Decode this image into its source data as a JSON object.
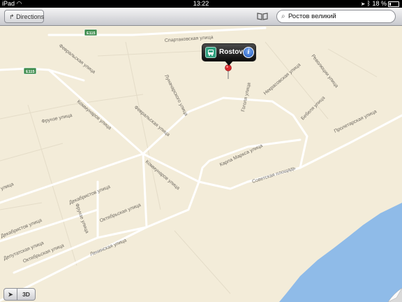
{
  "statusbar": {
    "device": "iPad",
    "time": "13:22",
    "battery": "18 %"
  },
  "toolbar": {
    "directions_label": "Directions",
    "search_value": "Ростов великий"
  },
  "callout": {
    "title": "Rostov"
  },
  "map": {
    "highway_labels": [
      "E115",
      "E115"
    ],
    "street_labels": [
      "Спартаковская улица",
      "Февральская улица",
      "Луначарского улица",
      "Гоголя улица",
      "Некрасовская улица",
      "Революции улица",
      "Бебеля улица",
      "Пролетарская улица",
      "Фрунзе улица",
      "Коммунаров улица",
      "Февральская улица",
      "Карла Маркса улица",
      "Коммунаров улица",
      "Советская площадь",
      "Декабристов улица",
      "Фрунзе улица",
      "Октябрьская улица",
      "Декабристов улица",
      "Депутатская улица",
      "Октябрьская улица",
      "Ленинская улица",
      "улица"
    ],
    "colors": {
      "land": "#f3ecd9",
      "road": "#ffffff",
      "water": "#8fbbe8"
    }
  },
  "bottom": {
    "three_d_label": "3D"
  }
}
